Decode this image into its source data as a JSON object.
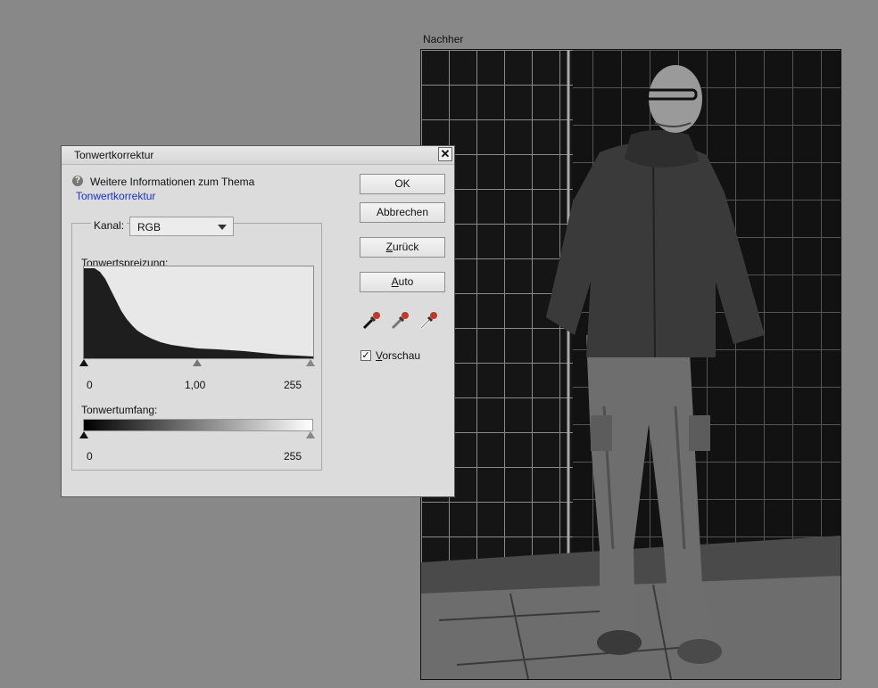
{
  "preview": {
    "label": "Nachher"
  },
  "dialog": {
    "title": "Tonwertkorrektur",
    "close_glyph": "✕",
    "help_icon": "question-icon",
    "help_text": "Weitere Informationen zum Thema",
    "help_link": "Tonwertkorrektur",
    "channel_label": "Kanal:",
    "channel_value": "RGB",
    "input_levels_label": "Tonwertspreizung:",
    "input_black": "0",
    "input_gamma": "1,00",
    "input_white": "255",
    "output_levels_label": "Tonwertumfang:",
    "output_black": "0",
    "output_white": "255",
    "buttons": {
      "ok": "OK",
      "cancel": "Abbrechen",
      "reset": "Zurück",
      "auto": "Auto"
    },
    "eyedroppers": [
      "black-eyedropper-icon",
      "gray-eyedropper-icon",
      "white-eyedropper-icon"
    ],
    "preview_checkbox": {
      "label": "Vorschau",
      "checked": true
    },
    "colors": {
      "link": "#1a2fd0",
      "eyedropper_red": "#c0392b"
    }
  }
}
